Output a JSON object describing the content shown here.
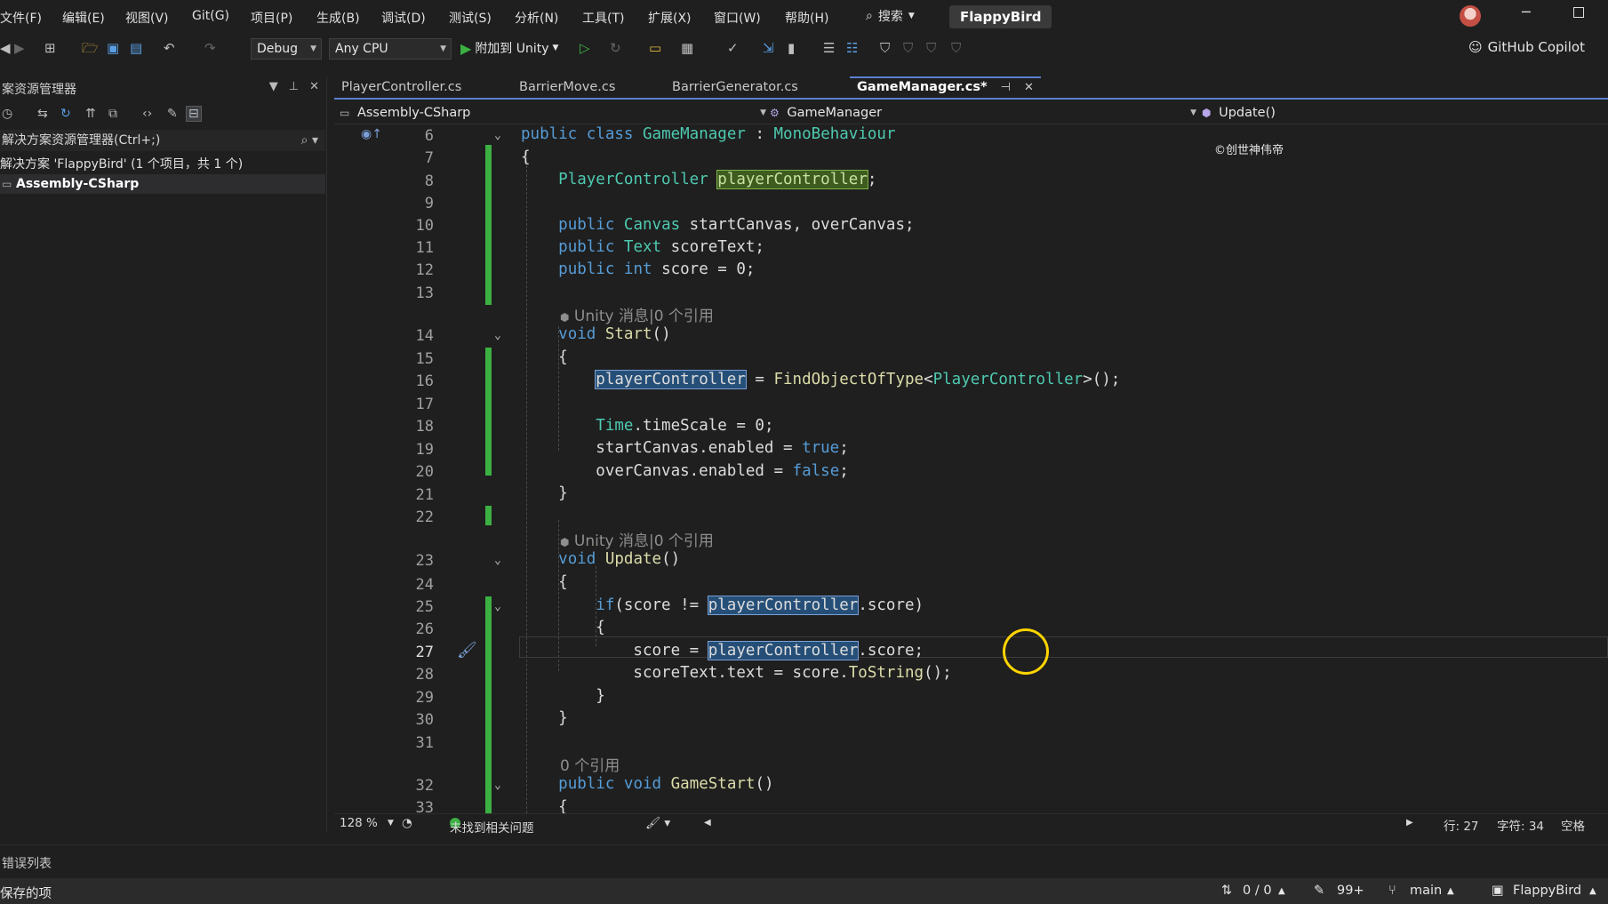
{
  "menubar": {
    "items": [
      "文件(F)",
      "编辑(E)",
      "视图(V)",
      "Git(G)",
      "项目(P)",
      "生成(B)",
      "调试(D)",
      "测试(S)",
      "分析(N)",
      "工具(T)",
      "扩展(X)",
      "窗口(W)",
      "帮助(H)"
    ],
    "search_label": "搜索",
    "solution_name": "FlappyBird"
  },
  "toolbar": {
    "config": "Debug",
    "platform": "Any CPU",
    "attach_label": "附加到 Unity",
    "copilot_label": "GitHub Copilot"
  },
  "solution_explorer": {
    "title": "案资源管理器",
    "search_placeholder": "解决方案资源管理器(Ctrl+;)",
    "solution_label": "解决方案 'FlappyBird' (1 个项目，共 1 个)",
    "project_label": "Assembly-CSharp"
  },
  "tabs": [
    {
      "label": "PlayerController.cs"
    },
    {
      "label": "BarrierMove.cs"
    },
    {
      "label": "BarrierGenerator.cs"
    },
    {
      "label": "GameManager.cs*"
    }
  ],
  "navbar": {
    "project": "Assembly-CSharp",
    "class": "GameManager",
    "member": "Update()"
  },
  "editor": {
    "watermark": "©创世神伟帝",
    "line_numbers": [
      "6",
      "7",
      "8",
      "9",
      "10",
      "11",
      "12",
      "13",
      "14",
      "15",
      "16",
      "17",
      "18",
      "19",
      "20",
      "21",
      "22",
      "23",
      "24",
      "25",
      "26",
      "27",
      "28",
      "29",
      "30",
      "31",
      "32",
      "33"
    ],
    "codelens": {
      "start": "Unity 消息|0 个引用",
      "update": "Unity 消息|0 个引用",
      "gamestart": "0 个引用"
    }
  },
  "editor_status": {
    "zoom": "128 %",
    "issues": "未找到相关问题",
    "line": "行: 27",
    "char": "字符: 34",
    "whitespace": "空格"
  },
  "errorlist": {
    "label": "错误列表"
  },
  "statusbar": {
    "saved": "保存的项",
    "sync": "0 / 0",
    "changes": "99+",
    "branch": "main",
    "repo": "FlappyBird"
  }
}
